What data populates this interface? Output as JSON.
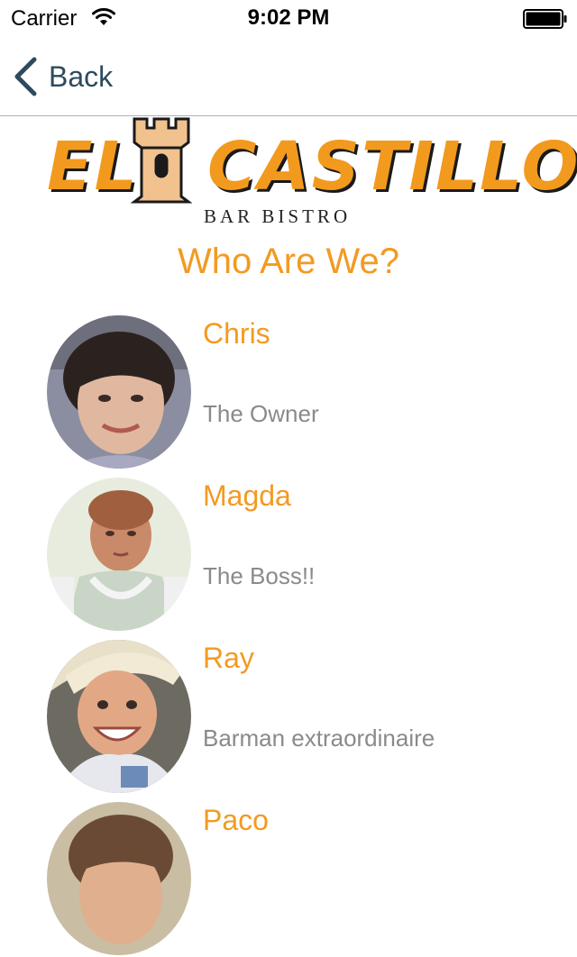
{
  "status_bar": {
    "carrier": "Carrier",
    "time": "9:02 PM"
  },
  "nav": {
    "back_label": "Back"
  },
  "logo": {
    "word1": "EL",
    "word2": "CASTILLO",
    "subtitle": "BAR BISTRO"
  },
  "page": {
    "title": "Who Are We?"
  },
  "team": [
    {
      "name": "Chris",
      "role": "The Owner"
    },
    {
      "name": "Magda",
      "role": "The Boss!!"
    },
    {
      "name": "Ray",
      "role": "Barman extraordinaire"
    },
    {
      "name": "Paco",
      "role": ""
    }
  ],
  "colors": {
    "accent": "#f39a22",
    "back_button": "#2e4a5e",
    "role_text": "#8a8a8a"
  }
}
